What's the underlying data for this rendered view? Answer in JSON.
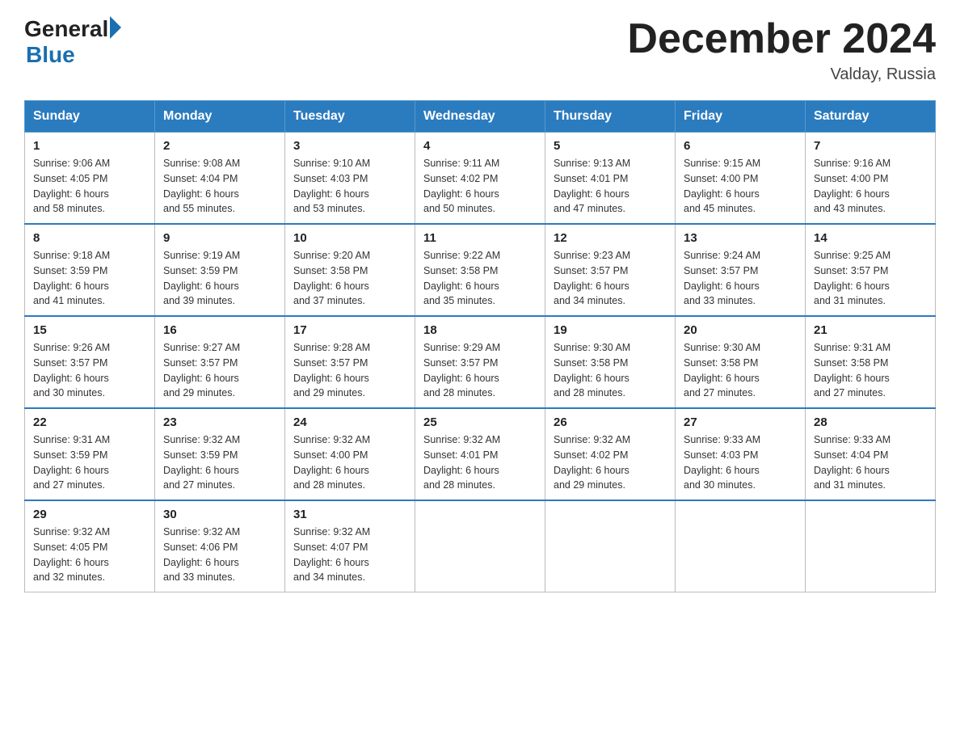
{
  "header": {
    "logo_general": "General",
    "logo_blue": "Blue",
    "month_title": "December 2024",
    "location": "Valday, Russia"
  },
  "days_of_week": [
    "Sunday",
    "Monday",
    "Tuesday",
    "Wednesday",
    "Thursday",
    "Friday",
    "Saturday"
  ],
  "weeks": [
    [
      {
        "day": "1",
        "sunrise": "9:06 AM",
        "sunset": "4:05 PM",
        "daylight": "6 hours and 58 minutes."
      },
      {
        "day": "2",
        "sunrise": "9:08 AM",
        "sunset": "4:04 PM",
        "daylight": "6 hours and 55 minutes."
      },
      {
        "day": "3",
        "sunrise": "9:10 AM",
        "sunset": "4:03 PM",
        "daylight": "6 hours and 53 minutes."
      },
      {
        "day": "4",
        "sunrise": "9:11 AM",
        "sunset": "4:02 PM",
        "daylight": "6 hours and 50 minutes."
      },
      {
        "day": "5",
        "sunrise": "9:13 AM",
        "sunset": "4:01 PM",
        "daylight": "6 hours and 47 minutes."
      },
      {
        "day": "6",
        "sunrise": "9:15 AM",
        "sunset": "4:00 PM",
        "daylight": "6 hours and 45 minutes."
      },
      {
        "day": "7",
        "sunrise": "9:16 AM",
        "sunset": "4:00 PM",
        "daylight": "6 hours and 43 minutes."
      }
    ],
    [
      {
        "day": "8",
        "sunrise": "9:18 AM",
        "sunset": "3:59 PM",
        "daylight": "6 hours and 41 minutes."
      },
      {
        "day": "9",
        "sunrise": "9:19 AM",
        "sunset": "3:59 PM",
        "daylight": "6 hours and 39 minutes."
      },
      {
        "day": "10",
        "sunrise": "9:20 AM",
        "sunset": "3:58 PM",
        "daylight": "6 hours and 37 minutes."
      },
      {
        "day": "11",
        "sunrise": "9:22 AM",
        "sunset": "3:58 PM",
        "daylight": "6 hours and 35 minutes."
      },
      {
        "day": "12",
        "sunrise": "9:23 AM",
        "sunset": "3:57 PM",
        "daylight": "6 hours and 34 minutes."
      },
      {
        "day": "13",
        "sunrise": "9:24 AM",
        "sunset": "3:57 PM",
        "daylight": "6 hours and 33 minutes."
      },
      {
        "day": "14",
        "sunrise": "9:25 AM",
        "sunset": "3:57 PM",
        "daylight": "6 hours and 31 minutes."
      }
    ],
    [
      {
        "day": "15",
        "sunrise": "9:26 AM",
        "sunset": "3:57 PM",
        "daylight": "6 hours and 30 minutes."
      },
      {
        "day": "16",
        "sunrise": "9:27 AM",
        "sunset": "3:57 PM",
        "daylight": "6 hours and 29 minutes."
      },
      {
        "day": "17",
        "sunrise": "9:28 AM",
        "sunset": "3:57 PM",
        "daylight": "6 hours and 29 minutes."
      },
      {
        "day": "18",
        "sunrise": "9:29 AM",
        "sunset": "3:57 PM",
        "daylight": "6 hours and 28 minutes."
      },
      {
        "day": "19",
        "sunrise": "9:30 AM",
        "sunset": "3:58 PM",
        "daylight": "6 hours and 28 minutes."
      },
      {
        "day": "20",
        "sunrise": "9:30 AM",
        "sunset": "3:58 PM",
        "daylight": "6 hours and 27 minutes."
      },
      {
        "day": "21",
        "sunrise": "9:31 AM",
        "sunset": "3:58 PM",
        "daylight": "6 hours and 27 minutes."
      }
    ],
    [
      {
        "day": "22",
        "sunrise": "9:31 AM",
        "sunset": "3:59 PM",
        "daylight": "6 hours and 27 minutes."
      },
      {
        "day": "23",
        "sunrise": "9:32 AM",
        "sunset": "3:59 PM",
        "daylight": "6 hours and 27 minutes."
      },
      {
        "day": "24",
        "sunrise": "9:32 AM",
        "sunset": "4:00 PM",
        "daylight": "6 hours and 28 minutes."
      },
      {
        "day": "25",
        "sunrise": "9:32 AM",
        "sunset": "4:01 PM",
        "daylight": "6 hours and 28 minutes."
      },
      {
        "day": "26",
        "sunrise": "9:32 AM",
        "sunset": "4:02 PM",
        "daylight": "6 hours and 29 minutes."
      },
      {
        "day": "27",
        "sunrise": "9:33 AM",
        "sunset": "4:03 PM",
        "daylight": "6 hours and 30 minutes."
      },
      {
        "day": "28",
        "sunrise": "9:33 AM",
        "sunset": "4:04 PM",
        "daylight": "6 hours and 31 minutes."
      }
    ],
    [
      {
        "day": "29",
        "sunrise": "9:32 AM",
        "sunset": "4:05 PM",
        "daylight": "6 hours and 32 minutes."
      },
      {
        "day": "30",
        "sunrise": "9:32 AM",
        "sunset": "4:06 PM",
        "daylight": "6 hours and 33 minutes."
      },
      {
        "day": "31",
        "sunrise": "9:32 AM",
        "sunset": "4:07 PM",
        "daylight": "6 hours and 34 minutes."
      },
      null,
      null,
      null,
      null
    ]
  ],
  "labels": {
    "sunrise": "Sunrise:",
    "sunset": "Sunset:",
    "daylight": "Daylight:"
  }
}
